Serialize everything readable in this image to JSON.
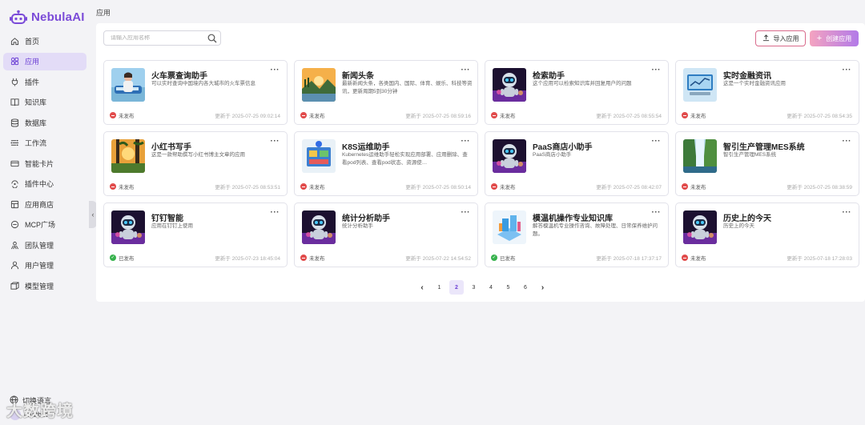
{
  "app": {
    "name": "NebulaAI",
    "brand_color": "#7b4bd8"
  },
  "sidebar": {
    "items": [
      {
        "label": "首页",
        "icon": "home-icon"
      },
      {
        "label": "应用",
        "icon": "apps-icon",
        "active": true
      },
      {
        "label": "插件",
        "icon": "plug-icon"
      },
      {
        "label": "知识库",
        "icon": "book-icon"
      },
      {
        "label": "数据库",
        "icon": "database-icon"
      },
      {
        "label": "工作流",
        "icon": "workflow-icon"
      },
      {
        "label": "智能卡片",
        "icon": "card-icon"
      },
      {
        "label": "插件中心",
        "icon": "plugin-center-icon"
      },
      {
        "label": "应用商店",
        "icon": "store-icon"
      },
      {
        "label": "MCP广场",
        "icon": "mcp-icon"
      },
      {
        "label": "团队管理",
        "icon": "team-icon"
      },
      {
        "label": "用户管理",
        "icon": "user-icon"
      },
      {
        "label": "模型管理",
        "icon": "model-icon"
      }
    ],
    "language_label": "切换语言",
    "user_name": "chatbot"
  },
  "watermark": "大数跨境",
  "breadcrumb": "应用",
  "search": {
    "placeholder": "请输入应用名称"
  },
  "toolbar": {
    "import_label": "导入应用",
    "create_label": "创建应用"
  },
  "cards": [
    {
      "title": "火车票查询助手",
      "desc": "可以实时查询中国境内各大城市的火车票信息",
      "status": "未发布",
      "published": false,
      "updated": "更新于 2025-07-25 09:02:14",
      "thumb": "train"
    },
    {
      "title": "新闻头条",
      "desc": "最新新闻头条，各类国内、国际、体育、娱乐、科技等资讯，更新周期5到30分钟",
      "status": "未发布",
      "published": false,
      "updated": "更新于 2025-07-25 08:59:16",
      "thumb": "landscape"
    },
    {
      "title": "检索助手",
      "desc": "这个应用可以检索知识库并回复用户的问题",
      "status": "未发布",
      "published": false,
      "updated": "更新于 2025-07-25 08:55:54",
      "thumb": "robot"
    },
    {
      "title": "实时金融资讯",
      "desc": "这是一个实时金融资讯应用",
      "status": "未发布",
      "published": false,
      "updated": "更新于 2025-07-25 08:54:35",
      "thumb": "finance"
    },
    {
      "title": "小红书写手",
      "desc": "这是一款帮助撰写小红书博主文章的应用",
      "status": "未发布",
      "published": false,
      "updated": "更新于 2025-07-25 08:53:51",
      "thumb": "forest"
    },
    {
      "title": "K8S运维助手",
      "desc": "Kubernetes运维助手轻松实现应用部署、应用删除、查看pod列表、查看pod状态、资源使…",
      "status": "未发布",
      "published": false,
      "updated": "更新于 2025-07-25 08:50:14",
      "thumb": "k8s"
    },
    {
      "title": "PaaS商店小助手",
      "desc": "PaaS商店小助手",
      "status": "未发布",
      "published": false,
      "updated": "更新于 2025-07-25 08:42:07",
      "thumb": "robot"
    },
    {
      "title": "智引生产管理MES系统",
      "desc": "智引生产管理MES系统",
      "status": "未发布",
      "published": false,
      "updated": "更新于 2025-07-25 08:38:59",
      "thumb": "waterfall"
    },
    {
      "title": "钉钉智能",
      "desc": "应用在钉钉上使用",
      "status": "已发布",
      "published": true,
      "updated": "更新于 2025-07-23 18:45:04",
      "thumb": "robot"
    },
    {
      "title": "统计分析助手",
      "desc": "统计分析助手",
      "status": "未发布",
      "published": false,
      "updated": "更新于 2025-07-22 14:54:52",
      "thumb": "robot"
    },
    {
      "title": "模温机操作专业知识库",
      "desc": "解答模温机专业操作咨询、故障处理、日常保养维护问题。",
      "status": "已发布",
      "published": true,
      "updated": "更新于 2025-07-18 17:37:17",
      "thumb": "factory"
    },
    {
      "title": "历史上的今天",
      "desc": "历史上的今天",
      "status": "未发布",
      "published": false,
      "updated": "更新于 2025-07-18 17:28:03",
      "thumb": "robot"
    }
  ],
  "pagination": {
    "prev": "‹",
    "next": "›",
    "pages": [
      "1",
      "2",
      "3",
      "4",
      "5",
      "6"
    ],
    "current": "2"
  },
  "colors": {
    "unpublished": "#e14b4b",
    "published": "#37b24d",
    "active_nav": "#e3dcf7"
  }
}
